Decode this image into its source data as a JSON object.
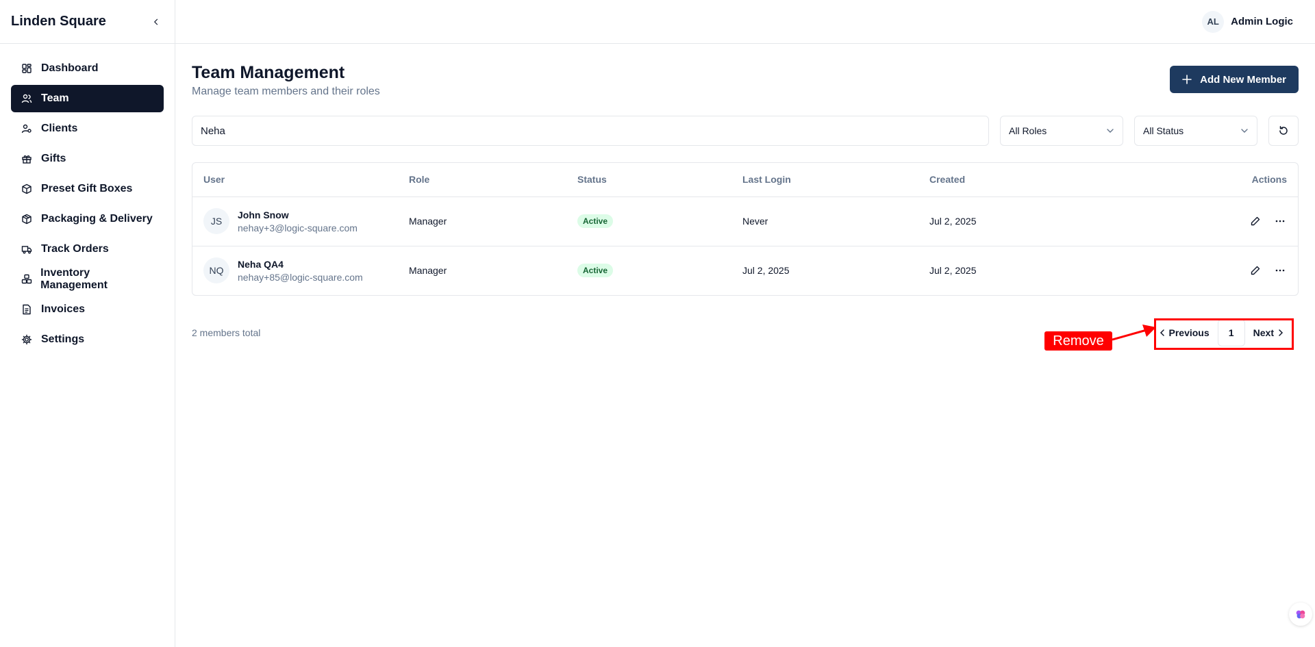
{
  "app": {
    "brand": "Linden Square"
  },
  "sidebar": {
    "items": [
      {
        "label": "Dashboard",
        "icon": "dashboard-icon",
        "active": false
      },
      {
        "label": "Team",
        "icon": "users-icon",
        "active": true
      },
      {
        "label": "Clients",
        "icon": "user-circle-icon",
        "active": false
      },
      {
        "label": "Gifts",
        "icon": "gift-icon",
        "active": false
      },
      {
        "label": "Preset Gift Boxes",
        "icon": "box-icon",
        "active": false
      },
      {
        "label": "Packaging & Delivery",
        "icon": "package-icon",
        "active": false
      },
      {
        "label": "Track Orders",
        "icon": "truck-icon",
        "active": false
      },
      {
        "label": "Inventory Management",
        "icon": "boxes-icon",
        "active": false
      },
      {
        "label": "Invoices",
        "icon": "document-icon",
        "active": false
      },
      {
        "label": "Settings",
        "icon": "gear-icon",
        "active": false
      }
    ]
  },
  "topbar": {
    "avatar_initials": "AL",
    "user_name": "Admin Logic"
  },
  "page": {
    "title": "Team Management",
    "subtitle": "Manage team members and their roles",
    "add_button": "Add New Member"
  },
  "filters": {
    "search_value": "Neha",
    "role_select": "All Roles",
    "status_select": "All Status"
  },
  "table": {
    "headers": {
      "user": "User",
      "role": "Role",
      "status": "Status",
      "last_login": "Last Login",
      "created": "Created",
      "actions": "Actions"
    },
    "rows": [
      {
        "initials": "JS",
        "name": "John Snow",
        "email": "nehay+3@logic-square.com",
        "role": "Manager",
        "status": "Active",
        "last_login": "Never",
        "created": "Jul 2, 2025"
      },
      {
        "initials": "NQ",
        "name": "Neha QA4",
        "email": "nehay+85@logic-square.com",
        "role": "Manager",
        "status": "Active",
        "last_login": "Jul 2, 2025",
        "created": "Jul 2, 2025"
      }
    ]
  },
  "footer": {
    "total": "2 members total",
    "prev": "Previous",
    "page": "1",
    "next": "Next"
  },
  "annotation": {
    "label": "Remove",
    "color": "#ff0000"
  },
  "colors": {
    "primary": "#0f172a",
    "accent_button": "#1e3a5f",
    "badge_bg": "#dcfce7",
    "badge_text": "#166534"
  }
}
